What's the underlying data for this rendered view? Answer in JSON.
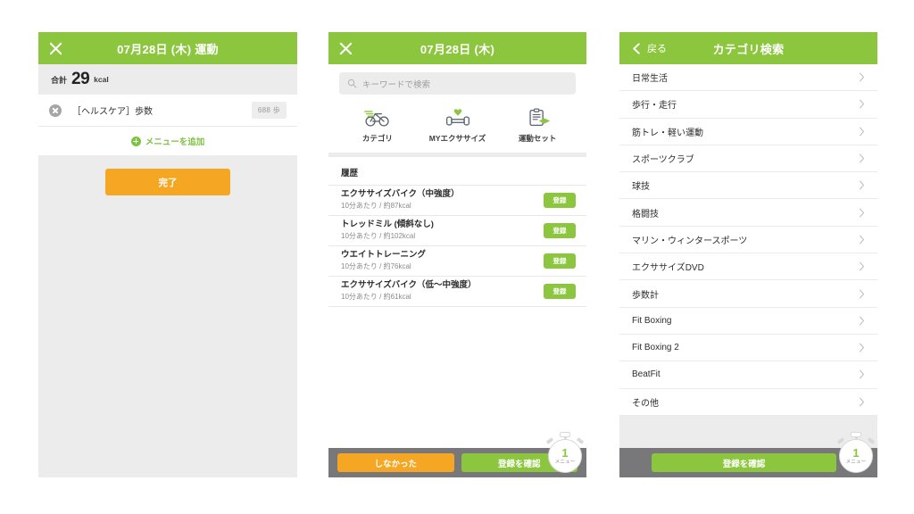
{
  "panel1": {
    "header": {
      "title": "07月28日 (木) 運動",
      "close_icon": "close-x-icon"
    },
    "summary": {
      "lead": "合計",
      "value": "29",
      "unit": "kcal"
    },
    "items": [
      {
        "label": "［ヘルスケア］歩数",
        "badge": "688 歩",
        "delete_icon": "circle-x-icon"
      }
    ],
    "add_menu": {
      "label": "メニューを追加",
      "icon": "plus-circle-icon"
    },
    "done_button": "完了"
  },
  "panel2": {
    "header": {
      "title": "07月28日 (木)",
      "close_icon": "close-x-icon"
    },
    "search": {
      "placeholder": "キーワードで検索",
      "icon": "search-icon"
    },
    "quick_actions": [
      {
        "label": "カテゴリ",
        "icon": "bicycle-icon"
      },
      {
        "label": "MYエクササイズ",
        "icon": "dumbbell-heart-icon"
      },
      {
        "label": "運動セット",
        "icon": "clipboard-icon"
      }
    ],
    "history_title": "履歴",
    "history": [
      {
        "name": "エクササイズバイク（中強度）",
        "sub": "10分あたり / 約87kcal",
        "action": "登録"
      },
      {
        "name": "トレッドミル (傾斜なし)",
        "sub": "10分あたり / 約102kcal",
        "action": "登録"
      },
      {
        "name": "ウエイトトレーニング",
        "sub": "10分あたり / 約76kcal",
        "action": "登録"
      },
      {
        "name": "エクササイズバイク（低〜中強度）",
        "sub": "10分あたり / 約61kcal",
        "action": "登録"
      }
    ],
    "bottom": {
      "skip_label": "しなかった",
      "confirm_label": "登録を確認",
      "stopwatch": {
        "count": "1",
        "label": "メニュー",
        "icon": "stopwatch-icon"
      }
    }
  },
  "panel3": {
    "header": {
      "title": "カテゴリ検索",
      "back_label": "戻る",
      "back_icon": "chevron-left-icon"
    },
    "categories": [
      {
        "label": "日常生活"
      },
      {
        "label": "歩行・走行"
      },
      {
        "label": "筋トレ・軽い運動"
      },
      {
        "label": "スポーツクラブ"
      },
      {
        "label": "球技"
      },
      {
        "label": "格闘技"
      },
      {
        "label": "マリン・ウィンタースポーツ"
      },
      {
        "label": "エクササイズDVD"
      },
      {
        "label": "歩数計"
      },
      {
        "label": "Fit Boxing"
      },
      {
        "label": "Fit Boxing 2"
      },
      {
        "label": "BeatFit"
      },
      {
        "label": "その他"
      }
    ],
    "bottom": {
      "confirm_label": "登録を確認",
      "stopwatch": {
        "count": "1",
        "label": "メニュー",
        "icon": "stopwatch-icon"
      }
    }
  },
  "colors": {
    "green": "#8cc63e",
    "orange": "#f5a623",
    "gray_bar": "#78787a",
    "light_gray": "#ececec"
  }
}
